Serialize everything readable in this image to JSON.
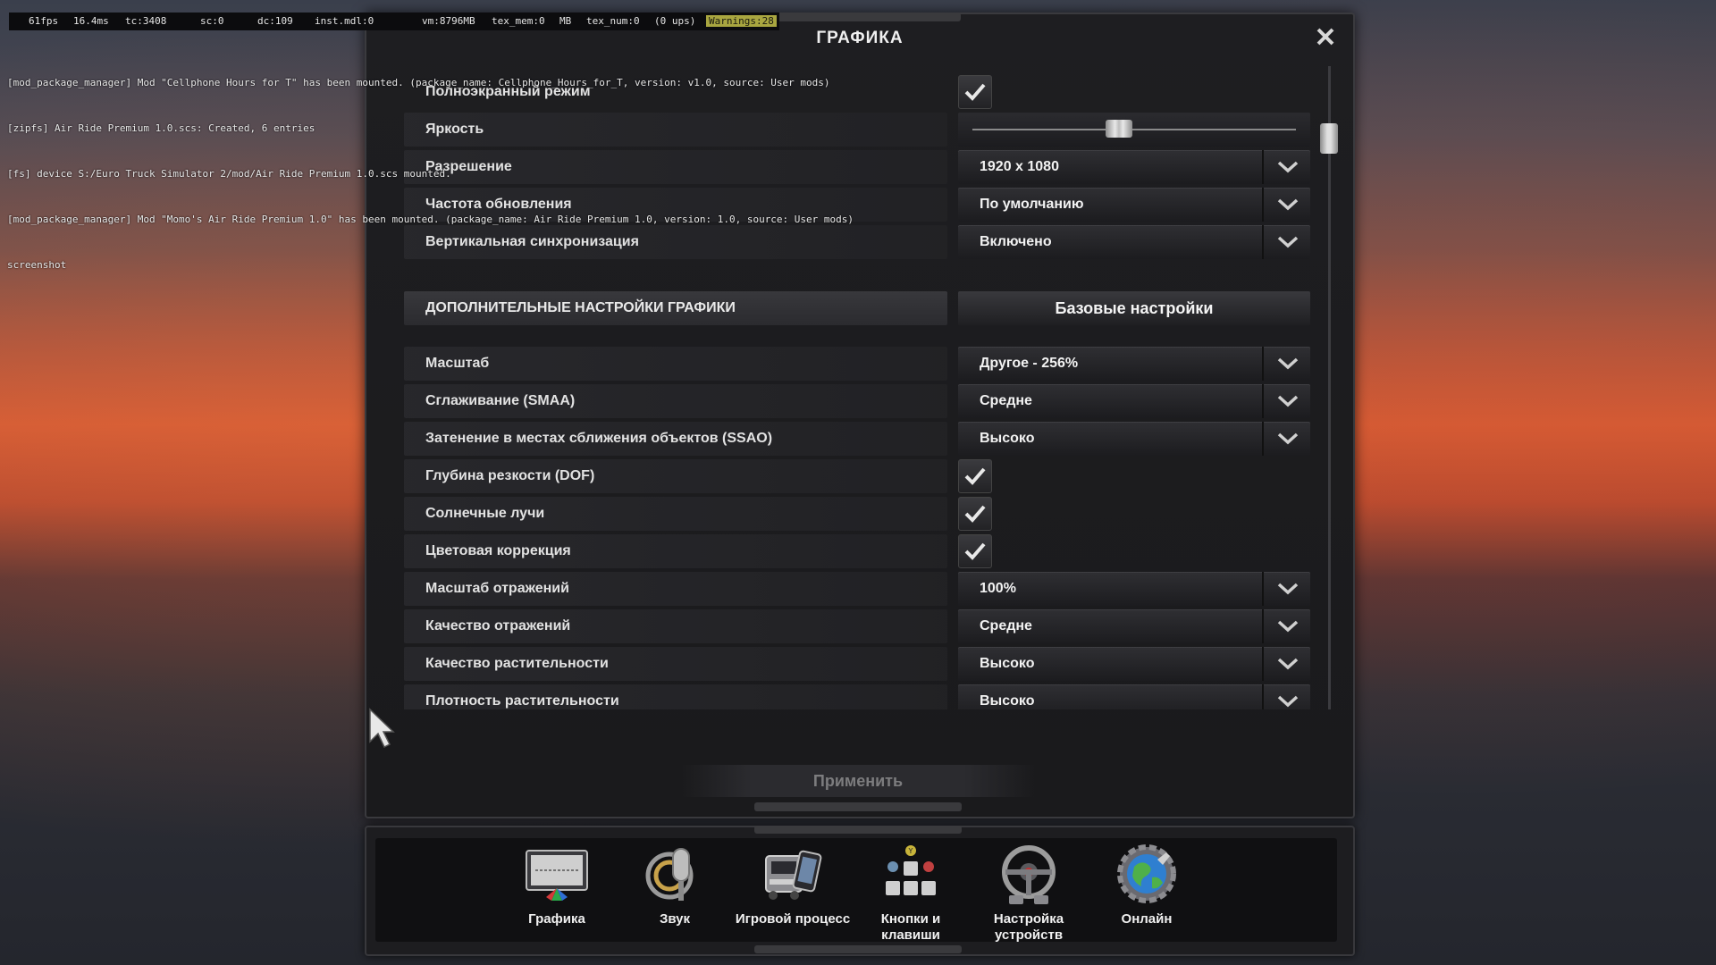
{
  "debug": {
    "fps": "61fps",
    "ms": "16.4ms",
    "tc": "tc:3408",
    "sc": "sc:0",
    "dc": "dc:109",
    "inst": "inst.mdl:0",
    "vm": "vm:8796MB",
    "tex_mem": "tex_mem:0",
    "mb": "MB",
    "tex_num": "tex_num:0",
    "ups": "(0 ups)",
    "warnings": "Warnings:28"
  },
  "console": [
    "[mod_package_manager] Mod \"Cellphone Hours for T\" has been mounted. (package_name: Cellphone_Hours_for_T, version: v1.0, source: User mods)",
    "[zipfs] Air Ride Premium 1.0.scs: Created, 6 entries",
    "[fs] device S:/Euro Truck Simulator 2/mod/Air Ride Premium 1.0.scs mounted.",
    "[mod_package_manager] Mod \"Momo's Air Ride Premium 1.0\" has been mounted. (package_name: Air Ride Premium 1.0, version: 1.0, source: User mods)",
    "screenshot"
  ],
  "dialog": {
    "title": "ГРАФИКА",
    "apply_label": "Применить"
  },
  "settings": {
    "fullscreen": {
      "label": "Полноэкранный режим",
      "checked": true
    },
    "brightness": {
      "label": "Яркость",
      "value": 0.45
    },
    "resolution": {
      "label": "Разрешение",
      "value": "1920 x 1080"
    },
    "refresh": {
      "label": "Частота обновления",
      "value": "По умолчанию"
    },
    "vsync": {
      "label": "Вертикальная синхронизация",
      "value": "Включено"
    },
    "advanced_header": "ДОПОЛНИТЕЛЬНЫЕ НАСТРОЙКИ ГРАФИКИ",
    "preset_button": "Базовые настройки",
    "scale": {
      "label": "Масштаб",
      "value": "Другое - 256%"
    },
    "smaa": {
      "label": "Сглаживание (SMAA)",
      "value": "Средне"
    },
    "ssao": {
      "label": "Затенение в местах сближения объектов (SSAO)",
      "value": "Высоко"
    },
    "dof": {
      "label": "Глубина резкости (DOF)",
      "checked": true
    },
    "sunshafts": {
      "label": "Солнечные лучи",
      "checked": true
    },
    "color_correction": {
      "label": "Цветовая коррекция",
      "checked": true
    },
    "reflection_scale": {
      "label": "Масштаб отражений",
      "value": "100%"
    },
    "reflection_quality": {
      "label": "Качество отражений",
      "value": "Средне"
    },
    "vegetation_quality": {
      "label": "Качество растительности",
      "value": "Высоко"
    },
    "vegetation_density": {
      "label": "Плотность растительности",
      "value": "Высоко"
    }
  },
  "toolbar": {
    "graphics": {
      "label": "Графика",
      "icon": "monitor-icon"
    },
    "sound": {
      "label": "Звук",
      "icon": "microphone-icon"
    },
    "gameplay": {
      "label": "Игровой процесс",
      "icon": "truck-phone-icon"
    },
    "keys": {
      "label": "Кнопки и клавиши",
      "icon": "gamepad-keys-icon"
    },
    "devices": {
      "label": "Настройка устройств",
      "icon": "steering-wheel-icon"
    },
    "online": {
      "label": "Онлайн",
      "icon": "globe-gear-icon"
    }
  },
  "colors": {
    "panel": "#1e1e21",
    "warning_bg": "#a9a640",
    "text": "#e2e2e2",
    "apply_disabled": "#7c7c7e"
  }
}
